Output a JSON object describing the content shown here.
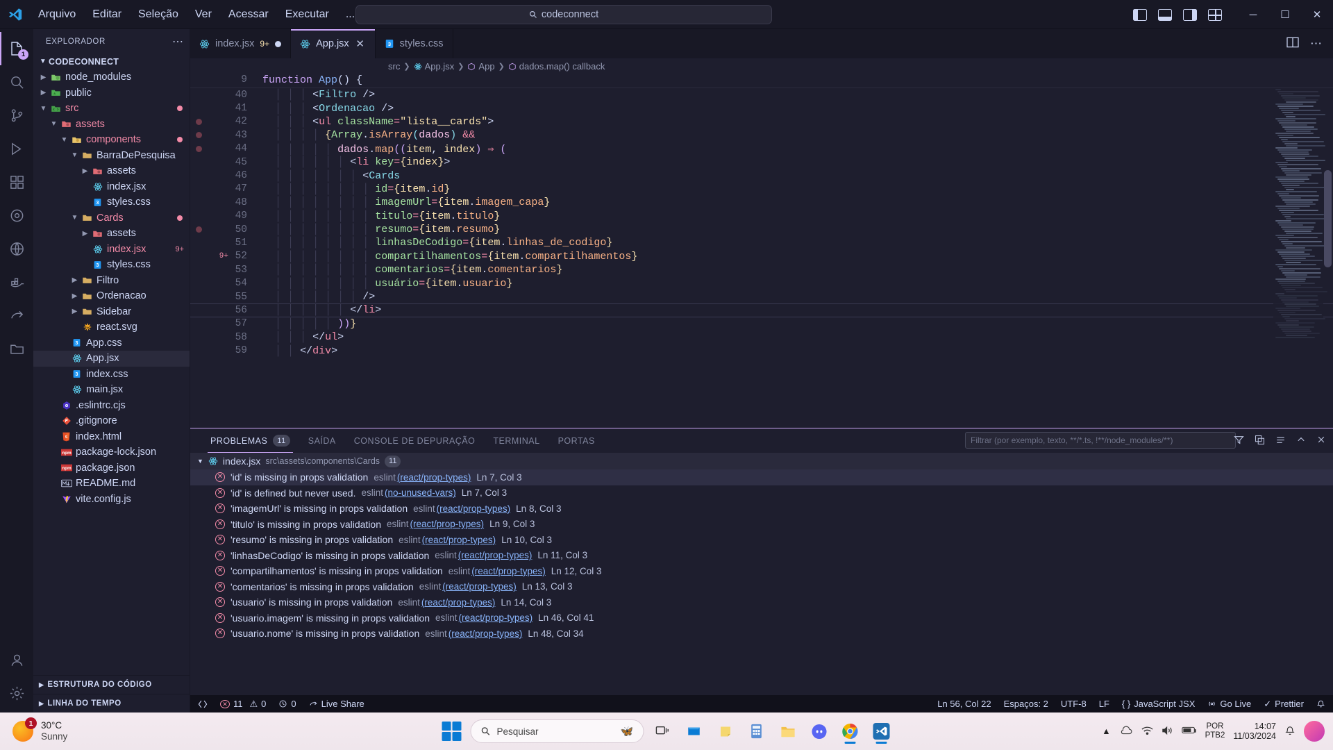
{
  "titlebar": {
    "menus": [
      "Arquivo",
      "Editar",
      "Seleção",
      "Ver",
      "Acessar",
      "Executar",
      "..."
    ],
    "back_icon": "arrow-left-icon",
    "forward_icon": "arrow-right-icon",
    "search_value": "codeconnect",
    "search_icon": "search-icon",
    "minimize": "─",
    "maximize": "☐",
    "close": "✕"
  },
  "activitybar": {
    "items": [
      {
        "name": "explorer",
        "badge": "1"
      },
      {
        "name": "search",
        "badge": ""
      },
      {
        "name": "source-control",
        "badge": ""
      },
      {
        "name": "run-debug",
        "badge": ""
      },
      {
        "name": "extensions",
        "badge": ""
      },
      {
        "name": "testing",
        "badge": ""
      },
      {
        "name": "remote-explorer",
        "badge": ""
      },
      {
        "name": "docker",
        "badge": ""
      },
      {
        "name": "live-share",
        "badge": ""
      },
      {
        "name": "folder-tools",
        "badge": ""
      }
    ],
    "bottom": [
      {
        "name": "accounts"
      },
      {
        "name": "settings"
      }
    ]
  },
  "sidebar": {
    "title": "EXPLORADOR",
    "more_icon": "more-actions-icon",
    "root": "CODECONNECT",
    "tree": [
      {
        "label": "node_modules",
        "depth": 1,
        "type": "folder",
        "expanded": false,
        "icon": "folder-node-icon",
        "color": "white",
        "badge": "",
        "dot": false
      },
      {
        "label": "public",
        "depth": 1,
        "type": "folder",
        "expanded": false,
        "icon": "folder-public-icon",
        "color": "white",
        "badge": "",
        "dot": false
      },
      {
        "label": "src",
        "depth": 1,
        "type": "folder",
        "expanded": true,
        "icon": "folder-src-icon",
        "color": "red",
        "badge": "",
        "dot": true
      },
      {
        "label": "assets",
        "depth": 2,
        "type": "folder",
        "expanded": true,
        "icon": "folder-assets-icon",
        "color": "red",
        "badge": "",
        "dot": false
      },
      {
        "label": "components",
        "depth": 3,
        "type": "folder",
        "expanded": true,
        "icon": "folder-components-icon",
        "color": "red",
        "badge": "",
        "dot": true
      },
      {
        "label": "BarraDePesquisa",
        "depth": 4,
        "type": "folder",
        "expanded": true,
        "icon": "folder-icon",
        "color": "white",
        "badge": "",
        "dot": false
      },
      {
        "label": "assets",
        "depth": 5,
        "type": "folder",
        "expanded": false,
        "icon": "folder-assets-icon",
        "color": "white",
        "badge": "",
        "dot": false
      },
      {
        "label": "index.jsx",
        "depth": 5,
        "type": "file",
        "icon": "react-icon",
        "color": "white",
        "badge": "",
        "dot": false
      },
      {
        "label": "styles.css",
        "depth": 5,
        "type": "file",
        "icon": "css-icon",
        "color": "white",
        "badge": "",
        "dot": false
      },
      {
        "label": "Cards",
        "depth": 4,
        "type": "folder",
        "expanded": true,
        "icon": "folder-icon",
        "color": "red",
        "badge": "",
        "dot": true
      },
      {
        "label": "assets",
        "depth": 5,
        "type": "folder",
        "expanded": false,
        "icon": "folder-assets-icon",
        "color": "white",
        "badge": "",
        "dot": false
      },
      {
        "label": "index.jsx",
        "depth": 5,
        "type": "file",
        "icon": "react-icon",
        "color": "red",
        "badge": "9+",
        "dot": false
      },
      {
        "label": "styles.css",
        "depth": 5,
        "type": "file",
        "icon": "css-icon",
        "color": "white",
        "badge": "",
        "dot": false
      },
      {
        "label": "Filtro",
        "depth": 4,
        "type": "folder",
        "expanded": false,
        "icon": "folder-icon",
        "color": "white",
        "badge": "",
        "dot": false
      },
      {
        "label": "Ordenacao",
        "depth": 4,
        "type": "folder",
        "expanded": false,
        "icon": "folder-icon",
        "color": "white",
        "badge": "",
        "dot": false
      },
      {
        "label": "Sidebar",
        "depth": 4,
        "type": "folder",
        "expanded": false,
        "icon": "folder-icon",
        "color": "white",
        "badge": "",
        "dot": false
      },
      {
        "label": "react.svg",
        "depth": 4,
        "type": "file",
        "icon": "svg-icon",
        "color": "white",
        "badge": "",
        "dot": false
      },
      {
        "label": "App.css",
        "depth": 3,
        "type": "file",
        "icon": "css-icon",
        "color": "white",
        "badge": "",
        "dot": false
      },
      {
        "label": "App.jsx",
        "depth": 3,
        "type": "file",
        "icon": "react-icon",
        "color": "white",
        "badge": "",
        "dot": false,
        "selected": true
      },
      {
        "label": "index.css",
        "depth": 3,
        "type": "file",
        "icon": "css-icon",
        "color": "white",
        "badge": "",
        "dot": false
      },
      {
        "label": "main.jsx",
        "depth": 3,
        "type": "file",
        "icon": "react-icon",
        "color": "white",
        "badge": "",
        "dot": false
      },
      {
        "label": ".eslintrc.cjs",
        "depth": 2,
        "type": "file",
        "icon": "eslint-icon",
        "color": "white",
        "badge": "",
        "dot": false
      },
      {
        "label": ".gitignore",
        "depth": 2,
        "type": "file",
        "icon": "git-icon",
        "color": "white",
        "badge": "",
        "dot": false
      },
      {
        "label": "index.html",
        "depth": 2,
        "type": "file",
        "icon": "html-icon",
        "color": "white",
        "badge": "",
        "dot": false
      },
      {
        "label": "package-lock.json",
        "depth": 2,
        "type": "file",
        "icon": "npm-icon",
        "color": "white",
        "badge": "",
        "dot": false
      },
      {
        "label": "package.json",
        "depth": 2,
        "type": "file",
        "icon": "npm-icon",
        "color": "white",
        "badge": "",
        "dot": false
      },
      {
        "label": "README.md",
        "depth": 2,
        "type": "file",
        "icon": "markdown-icon",
        "color": "white",
        "badge": "",
        "dot": false
      },
      {
        "label": "vite.config.js",
        "depth": 2,
        "type": "file",
        "icon": "vite-icon",
        "color": "white",
        "badge": "",
        "dot": false
      }
    ],
    "sections": [
      {
        "label": "ESTRUTURA DO CÓDIGO"
      },
      {
        "label": "LINHA DO TEMPO"
      }
    ]
  },
  "tabs": [
    {
      "label": "index.jsx",
      "icon": "react-icon",
      "badge": "9+",
      "modified": true,
      "active": false
    },
    {
      "label": "App.jsx",
      "icon": "react-icon",
      "badge": "",
      "modified": false,
      "active": true,
      "close": "✕"
    },
    {
      "label": "styles.css",
      "icon": "css-icon",
      "badge": "",
      "modified": false,
      "active": false
    }
  ],
  "tabs_right": {
    "split_icon": "split-editor-icon",
    "more_icon": "more-actions-icon"
  },
  "breadcrumb": [
    "src",
    "App.jsx",
    "App",
    "dados.map() callback"
  ],
  "sticky": {
    "line_number": "9",
    "text": "function App() {"
  },
  "code": {
    "lines": [
      {
        "n": "40",
        "text": "        <Filtro />",
        "bp": false,
        "chg": ""
      },
      {
        "n": "41",
        "text": "        <Ordenacao />",
        "bp": false,
        "chg": ""
      },
      {
        "n": "42",
        "text": "        <ul className=\"lista__cards\">",
        "bp": true,
        "chg": ""
      },
      {
        "n": "43",
        "text": "          {Array.isArray(dados) &&",
        "bp": true,
        "chg": ""
      },
      {
        "n": "44",
        "text": "            dados.map((item, index) => (",
        "bp": true,
        "chg": ""
      },
      {
        "n": "45",
        "text": "              <li key={index}>",
        "bp": false,
        "chg": ""
      },
      {
        "n": "46",
        "text": "                <Cards",
        "bp": false,
        "chg": ""
      },
      {
        "n": "47",
        "text": "                  id={item.id}",
        "bp": false,
        "chg": ""
      },
      {
        "n": "48",
        "text": "                  imagemUrl={item.imagem_capa}",
        "bp": false,
        "chg": ""
      },
      {
        "n": "49",
        "text": "                  titulo={item.titulo}",
        "bp": false,
        "chg": ""
      },
      {
        "n": "50",
        "text": "                  resumo={item.resumo}",
        "bp": true,
        "chg": ""
      },
      {
        "n": "51",
        "text": "                  linhasDeCodigo={item.linhas_de_codigo}",
        "bp": false,
        "chg": ""
      },
      {
        "n": "52",
        "text": "                  compartilhamentos={item.compartilhamentos}",
        "bp": false,
        "chg": "9+"
      },
      {
        "n": "53",
        "text": "                  comentarios={item.comentarios}",
        "bp": false,
        "chg": ""
      },
      {
        "n": "54",
        "text": "                  usuário={item.usuario}",
        "bp": false,
        "chg": ""
      },
      {
        "n": "55",
        "text": "                />",
        "bp": false,
        "chg": ""
      },
      {
        "n": "56",
        "text": "              </li>",
        "bp": false,
        "chg": "",
        "current": true
      },
      {
        "n": "57",
        "text": "            ))}",
        "bp": false,
        "chg": ""
      },
      {
        "n": "58",
        "text": "        </ul>",
        "bp": false,
        "chg": ""
      },
      {
        "n": "59",
        "text": "      </div>",
        "bp": false,
        "chg": ""
      }
    ]
  },
  "panel": {
    "tabs": [
      {
        "label": "PROBLEMAS",
        "count": "11",
        "active": true
      },
      {
        "label": "SAÍDA",
        "count": "",
        "active": false
      },
      {
        "label": "CONSOLE DE DEPURAÇÃO",
        "count": "",
        "active": false
      },
      {
        "label": "TERMINAL",
        "count": "",
        "active": false
      },
      {
        "label": "PORTAS",
        "count": "",
        "active": false
      }
    ],
    "filter_placeholder": "Filtrar (por exemplo, texto, **/*.ts, !**/node_modules/**)",
    "actions": [
      "filter-icon",
      "collapse-all-icon",
      "list-icon",
      "chevron-up-icon",
      "close-icon"
    ],
    "group": {
      "file": "index.jsx",
      "path": "src\\assets\\components\\Cards",
      "count": "11",
      "icon": "react-icon",
      "chevron": "chevron-down-icon"
    },
    "problems": [
      {
        "message": "'id' is missing in props validation",
        "source": "eslint",
        "rule": "(react/prop-types)",
        "location": "Ln 7, Col 3",
        "selected": true
      },
      {
        "message": "'id' is defined but never used.",
        "source": "eslint",
        "rule": "(no-unused-vars)",
        "location": "Ln 7, Col 3",
        "selected": false
      },
      {
        "message": "'imagemUrl' is missing in props validation",
        "source": "eslint",
        "rule": "(react/prop-types)",
        "location": "Ln 8, Col 3",
        "selected": false
      },
      {
        "message": "'titulo' is missing in props validation",
        "source": "eslint",
        "rule": "(react/prop-types)",
        "location": "Ln 9, Col 3",
        "selected": false
      },
      {
        "message": "'resumo' is missing in props validation",
        "source": "eslint",
        "rule": "(react/prop-types)",
        "location": "Ln 10, Col 3",
        "selected": false
      },
      {
        "message": "'linhasDeCodigo' is missing in props validation",
        "source": "eslint",
        "rule": "(react/prop-types)",
        "location": "Ln 11, Col 3",
        "selected": false
      },
      {
        "message": "'compartilhamentos' is missing in props validation",
        "source": "eslint",
        "rule": "(react/prop-types)",
        "location": "Ln 12, Col 3",
        "selected": false
      },
      {
        "message": "'comentarios' is missing in props validation",
        "source": "eslint",
        "rule": "(react/prop-types)",
        "location": "Ln 13, Col 3",
        "selected": false
      },
      {
        "message": "'usuario' is missing in props validation",
        "source": "eslint",
        "rule": "(react/prop-types)",
        "location": "Ln 14, Col 3",
        "selected": false
      },
      {
        "message": "'usuario.imagem' is missing in props validation",
        "source": "eslint",
        "rule": "(react/prop-types)",
        "location": "Ln 46, Col 41",
        "selected": false
      },
      {
        "message": "'usuario.nome' is missing in props validation",
        "source": "eslint",
        "rule": "(react/prop-types)",
        "location": "Ln 48, Col 34",
        "selected": false
      }
    ]
  },
  "statusbar": {
    "remote_icon": "remote-window-icon",
    "errors": "11",
    "warnings": "0",
    "ports": "0",
    "live_share": "Live Share",
    "position": "Ln 56, Col 22",
    "indent": "Espaços: 2",
    "encoding": "UTF-8",
    "eol": "LF",
    "language": "JavaScript JSX",
    "go_live": "Go Live",
    "formatter": "Prettier",
    "bell_icon": "notifications-bell-icon"
  },
  "taskbar": {
    "weather_temp": "30°C",
    "weather_desc": "Sunny",
    "weather_badge": "1",
    "search_placeholder": "Pesquisar",
    "icons": [
      {
        "name": "task-view-icon"
      },
      {
        "name": "microsoft-store-icon"
      },
      {
        "name": "sticky-notes-icon"
      },
      {
        "name": "calculator-icon"
      },
      {
        "name": "file-explorer-icon"
      },
      {
        "name": "discord-icon"
      },
      {
        "name": "chrome-icon"
      },
      {
        "name": "vscode-icon"
      }
    ],
    "language": "POR",
    "language_sub": "PTB2",
    "time": "14:07",
    "date": "11/03/2024"
  }
}
